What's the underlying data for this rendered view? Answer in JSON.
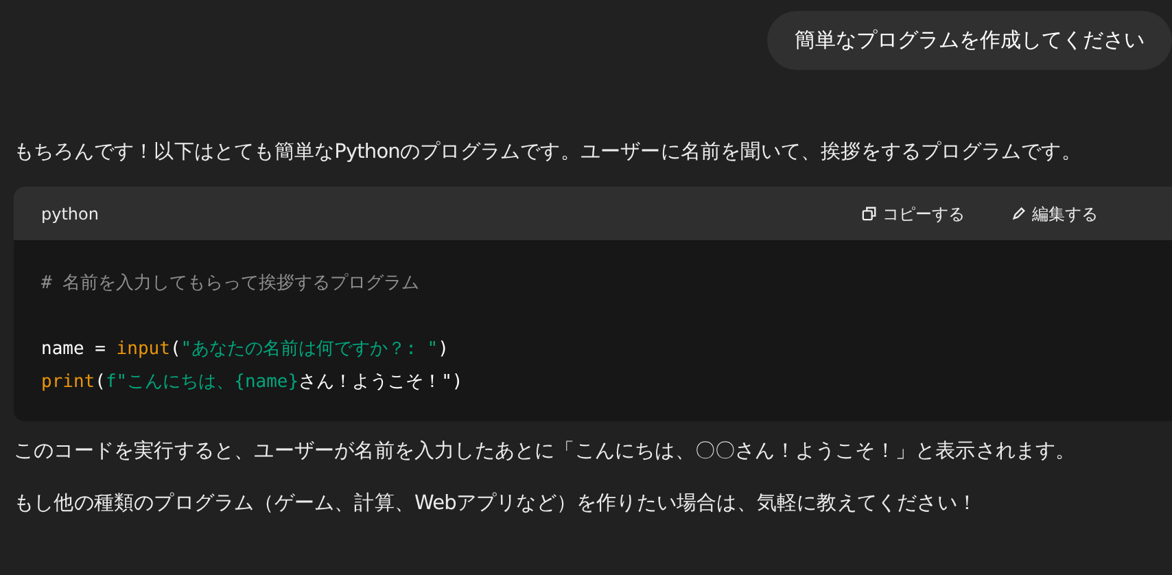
{
  "user_message": "簡単なプログラムを作成してください",
  "reply_intro": "もちろんです！以下はとても簡単なPythonのプログラムです。ユーザーに名前を聞いて、挨拶をするプログラムです。",
  "code_block": {
    "language": "python",
    "actions": [
      {
        "label": "コピーする",
        "kind": "copy"
      },
      {
        "label": "編集する",
        "kind": "edit"
      }
    ],
    "line_groups": [
      [
        [
          {
            "kind": "comment",
            "text": "# 名前を入力してもらって挨拶するプログラム"
          }
        ]
      ],
      [
        [
          {
            "kind": "plain",
            "text": "name = "
          },
          {
            "kind": "func",
            "text": "input"
          },
          {
            "kind": "plain",
            "text": "("
          },
          {
            "kind": "string",
            "text": "\"あなたの名前は何ですか？: \""
          },
          {
            "kind": "plain",
            "text": ")"
          }
        ],
        [
          {
            "kind": "func",
            "text": "print"
          },
          {
            "kind": "plain",
            "text": "("
          },
          {
            "kind": "string",
            "text": "f\"こんにちは、{name}"
          },
          {
            "kind": "plain",
            "text": "さん！ようこそ！\")"
          }
        ]
      ]
    ]
  },
  "reply_paragraphs": [
    "このコードを実行すると、ユーザーが名前を入力したあとに「こんにちは、〇〇さん！ようこそ！」と表示されます。",
    "もし他の種類のプログラム（ゲーム、計算、Webアプリなど）を作りたい場合は、気軽に教えてください！"
  ]
}
